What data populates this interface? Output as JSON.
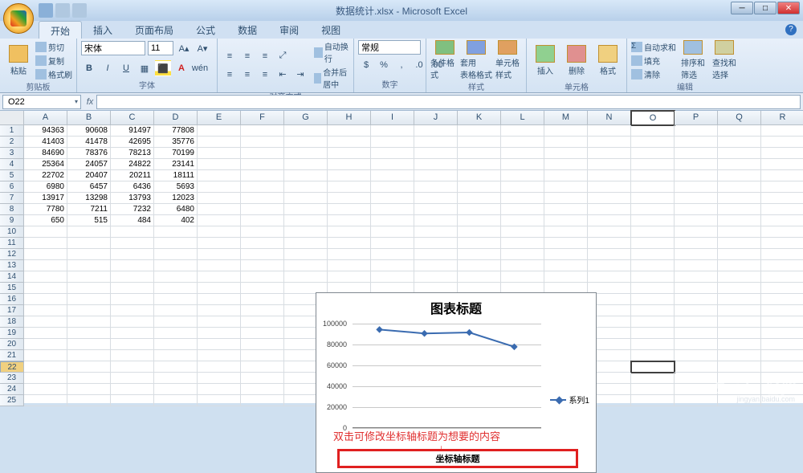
{
  "title": "数据统计.xlsx - Microsoft Excel",
  "qat": {
    "save": "save-icon",
    "undo": "undo-icon",
    "redo": "redo-icon"
  },
  "tabs": {
    "home": "开始",
    "insert": "插入",
    "layout": "页面布局",
    "formula": "公式",
    "data": "数据",
    "review": "审阅",
    "view": "视图"
  },
  "ribbon": {
    "clipboard": {
      "paste": "粘贴",
      "cut": "剪切",
      "copy": "复制",
      "painter": "格式刷",
      "label": "剪贴板"
    },
    "font": {
      "name": "宋体",
      "size": "11",
      "label": "字体"
    },
    "align": {
      "wrap": "自动换行",
      "merge": "合并后居中",
      "label": "对齐方式"
    },
    "number": {
      "format": "常规",
      "label": "数字"
    },
    "styles": {
      "cond": "条件格式",
      "table": "套用\n表格格式",
      "cell": "单元格\n样式",
      "label": "样式"
    },
    "cells": {
      "insert": "插入",
      "delete": "删除",
      "format": "格式",
      "label": "单元格"
    },
    "editing": {
      "autosum": "自动求和",
      "fill": "填充",
      "clear": "清除",
      "sort": "排序和\n筛选",
      "find": "查找和\n选择",
      "label": "编辑"
    }
  },
  "namebox": "O22",
  "columns": [
    "A",
    "B",
    "C",
    "D",
    "E",
    "F",
    "G",
    "H",
    "I",
    "J",
    "K",
    "L",
    "M",
    "N",
    "O",
    "P",
    "Q",
    "R"
  ],
  "visible_rows": 25,
  "selected_row": 22,
  "selected_col_idx": 14,
  "table": [
    [
      94363,
      90608,
      91497,
      77808
    ],
    [
      41403,
      41478,
      42695,
      35776
    ],
    [
      84690,
      78376,
      78213,
      70199
    ],
    [
      25364,
      24057,
      24822,
      23141
    ],
    [
      22702,
      20407,
      20211,
      18111
    ],
    [
      6980,
      6457,
      6436,
      5693
    ],
    [
      13917,
      13298,
      13793,
      12023
    ],
    [
      7780,
      7211,
      7232,
      6480
    ],
    [
      650,
      515,
      484,
      402
    ]
  ],
  "chart_data": {
    "type": "line",
    "title": "图表标题",
    "axis_title": "坐标轴标题",
    "series": [
      {
        "name": "系列1",
        "values": [
          94363,
          90608,
          91497,
          77808
        ]
      }
    ],
    "x": [
      1,
      2,
      3,
      4
    ],
    "ylim": [
      0,
      100000
    ],
    "yticks": [
      0,
      20000,
      40000,
      60000,
      80000,
      100000
    ],
    "annotation": "双击可修改坐标轴标题为想要的内容"
  },
  "watermark": {
    "brand": "Baidu 经验",
    "url": "jingyan.baidu.com"
  }
}
